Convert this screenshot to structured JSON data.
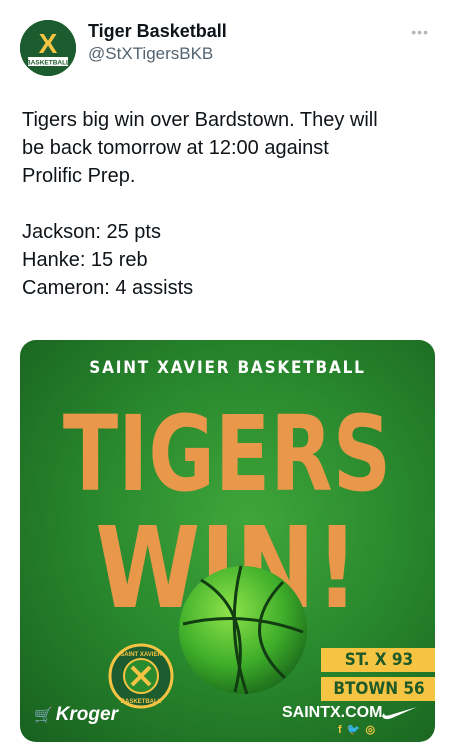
{
  "account": {
    "display_name": "Tiger Basketball",
    "handle": "@StXTigersBKB",
    "avatar_letter": "X",
    "avatar_text": "BASKETBALL",
    "more_icon": "more-horizontal-icon"
  },
  "tweet": {
    "line1": "Tigers big win over Bardstown. They will",
    "line2": "be back tomorrow at 12:00 against",
    "line3": "Prolific Prep.",
    "stat1": "Jackson: 25 pts",
    "stat2": "Hanke: 15 reb",
    "stat3": "Cameron: 4 assists"
  },
  "graphic": {
    "title": "SAINT XAVIER BASKETBALL",
    "headline1": "TIGERS",
    "headline2": "WIN!",
    "score_home": "ST. X 93",
    "score_away": "BTOWN 56",
    "sponsor": "Kroger",
    "seal_top": "SAINT XAVIER",
    "seal_bottom": "BASKETBALL",
    "website": "SAINTX.COM",
    "colors": {
      "green": "#2a8a2e",
      "orange": "#e9974a",
      "gold": "#f6c443"
    }
  }
}
